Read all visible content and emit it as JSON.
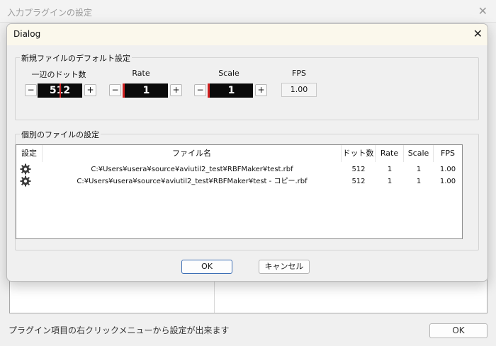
{
  "background_window": {
    "title": "入力プラグインの設定",
    "status_text": "プラグイン項目の右クリックメニューから設定が出来ます",
    "ok_label": "OK"
  },
  "dialog": {
    "title": "Dialog",
    "defaults_group": {
      "label": "新規ファイルのデフォルト設定",
      "dot_count": {
        "label": "一辺のドット数",
        "value": "512",
        "minus": "−",
        "plus": "+"
      },
      "rate": {
        "label": "Rate",
        "value": "1",
        "minus": "−",
        "plus": "+"
      },
      "scale": {
        "label": "Scale",
        "value": "1",
        "minus": "−",
        "plus": "+"
      },
      "fps": {
        "label": "FPS",
        "value": "1.00"
      }
    },
    "files_group": {
      "label": "個別のファイルの設定",
      "columns": [
        "設定",
        "ファイル名",
        "ドット数",
        "Rate",
        "Scale",
        "FPS"
      ],
      "rows": [
        {
          "file": "C:¥Users¥usera¥source¥aviutil2_test¥RBFMaker¥test.rbf",
          "dots": "512",
          "rate": "1",
          "scale": "1",
          "fps": "1.00"
        },
        {
          "file": "C:¥Users¥usera¥source¥aviutil2_test¥RBFMaker¥test - コピー.rbf",
          "dots": "512",
          "rate": "1",
          "scale": "1",
          "fps": "1.00"
        }
      ]
    },
    "ok_label": "OK",
    "cancel_label": "キャンセル"
  }
}
